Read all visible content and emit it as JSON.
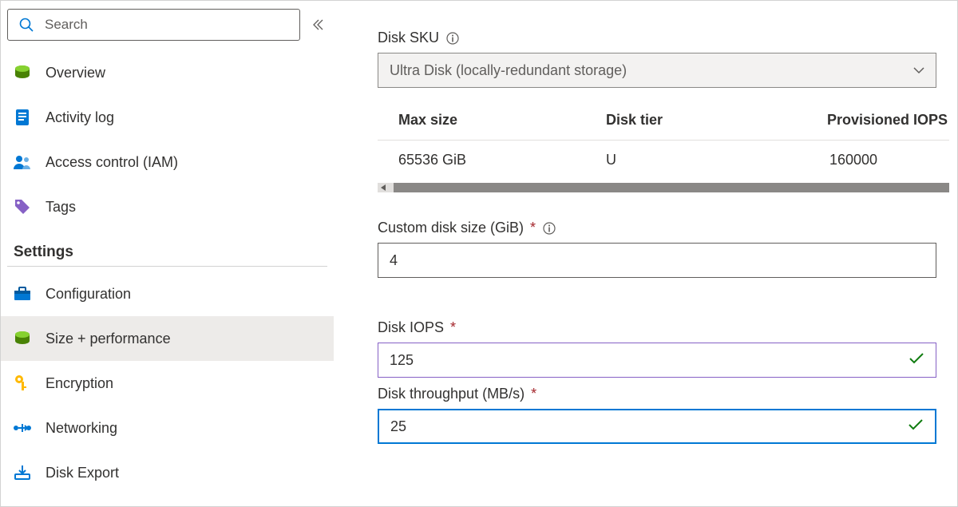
{
  "search": {
    "placeholder": "Search"
  },
  "sidebar": {
    "items": [
      {
        "label": "Overview"
      },
      {
        "label": "Activity log"
      },
      {
        "label": "Access control (IAM)"
      },
      {
        "label": "Tags"
      }
    ],
    "settings_header": "Settings",
    "settings": [
      {
        "label": "Configuration"
      },
      {
        "label": "Size + performance"
      },
      {
        "label": "Encryption"
      },
      {
        "label": "Networking"
      },
      {
        "label": "Disk Export"
      }
    ]
  },
  "main": {
    "disk_sku_label": "Disk SKU",
    "disk_sku_value": "Ultra Disk (locally-redundant storage)",
    "table": {
      "headers": {
        "c1": "Max size",
        "c2": "Disk tier",
        "c3": "Provisioned IOPS"
      },
      "row": {
        "c1": "65536 GiB",
        "c2": "U",
        "c3": "160000"
      }
    },
    "custom_size_label": "Custom disk size (GiB)",
    "custom_size_value": "4",
    "iops_label": "Disk IOPS",
    "iops_value": "125",
    "throughput_label": "Disk throughput (MB/s)",
    "throughput_value": "25"
  }
}
